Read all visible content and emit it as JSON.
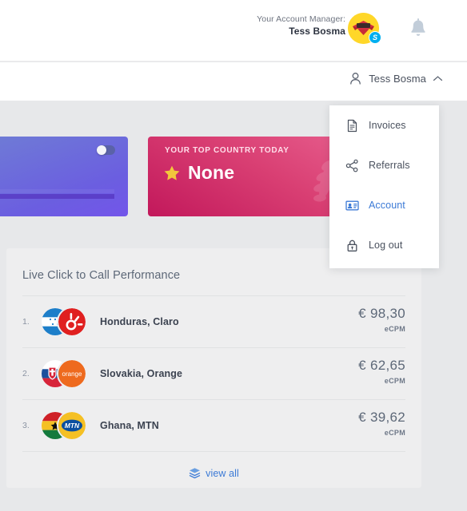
{
  "header": {
    "account_manager_label": "Your Account Manager:",
    "account_manager_name": "Tess Bosma",
    "skype_badge": "S",
    "avatar_icon": "avatar-image",
    "bell_icon": "bell-icon"
  },
  "nav": {
    "user_name": "Tess Bosma",
    "user_icon": "user-icon",
    "chevron_icon": "chevron-up-icon"
  },
  "dropdown": {
    "items": [
      {
        "label": "Invoices",
        "icon": "document-icon",
        "active": false
      },
      {
        "label": "Referrals",
        "icon": "share-icon",
        "active": false
      },
      {
        "label": "Account",
        "icon": "id-card-icon",
        "active": true
      },
      {
        "label": "Log out",
        "icon": "lock-icon",
        "active": false
      }
    ]
  },
  "cards": {
    "purple": {
      "toggle_state": "off",
      "toggle_icon": "toggle-switch"
    },
    "pink": {
      "label": "YOUR TOP COUNTRY TODAY",
      "value": "None",
      "star_icon": "star-icon",
      "watermark_letter": "R"
    }
  },
  "performance": {
    "title": "Live Click to Call Performance",
    "currency_symbol": "€",
    "unit_label": "eCPM",
    "rows": [
      {
        "rank": "1.",
        "route": "Honduras, Claro",
        "price": "€ 98,30",
        "unit": "eCPM",
        "flag": "honduras-flag",
        "operator": "claro-logo"
      },
      {
        "rank": "2.",
        "route": "Slovakia, Orange",
        "price": "€ 62,65",
        "unit": "eCPM",
        "flag": "slovakia-flag",
        "operator": "orange-logo"
      },
      {
        "rank": "3.",
        "route": "Ghana, MTN",
        "price": "€ 39,62",
        "unit": "eCPM",
        "flag": "ghana-flag",
        "operator": "mtn-logo"
      }
    ],
    "view_all_label": "view all",
    "view_all_icon": "layers-icon"
  },
  "colors": {
    "accent_blue": "#3c7ad6",
    "card_pink": "#d93f73",
    "card_purple": "#6b5ee0",
    "page_bg": "#e7e8ea",
    "panel_bg": "#eeeeef",
    "text_dark": "#3b4250",
    "text_muted": "#5d6878"
  }
}
